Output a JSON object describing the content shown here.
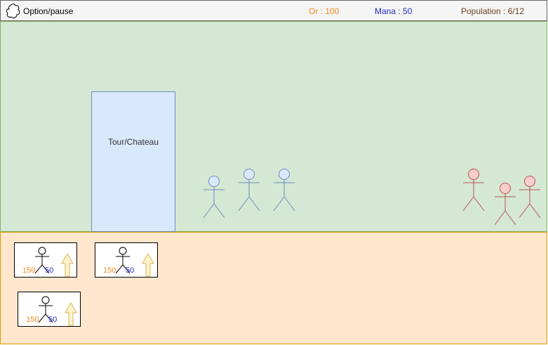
{
  "topbar": {
    "option_label": "Option/pause",
    "gold": "Or : 100",
    "mana": "Mana : 50",
    "population": "Population : 6/12"
  },
  "field": {
    "castle_label": "Tour/Chateau",
    "allies_count": 3,
    "enemies_count": 3
  },
  "shop": {
    "cards": [
      {
        "gold_cost": "150",
        "mana_cost": "50"
      },
      {
        "gold_cost": "150",
        "mana_cost": "50"
      },
      {
        "gold_cost": "150",
        "mana_cost": "50"
      }
    ]
  },
  "colors": {
    "field_bg": "#d5e8d4",
    "shop_bg": "#ffe6cc",
    "castle_bg": "#dae8fc",
    "ally": "#6c8ebf",
    "enemy": "#b85450",
    "gold": "#f08a1c",
    "mana": "#2828c8"
  },
  "icons": {
    "option": "cloud-icon",
    "upgrade": "up-arrow-icon"
  }
}
